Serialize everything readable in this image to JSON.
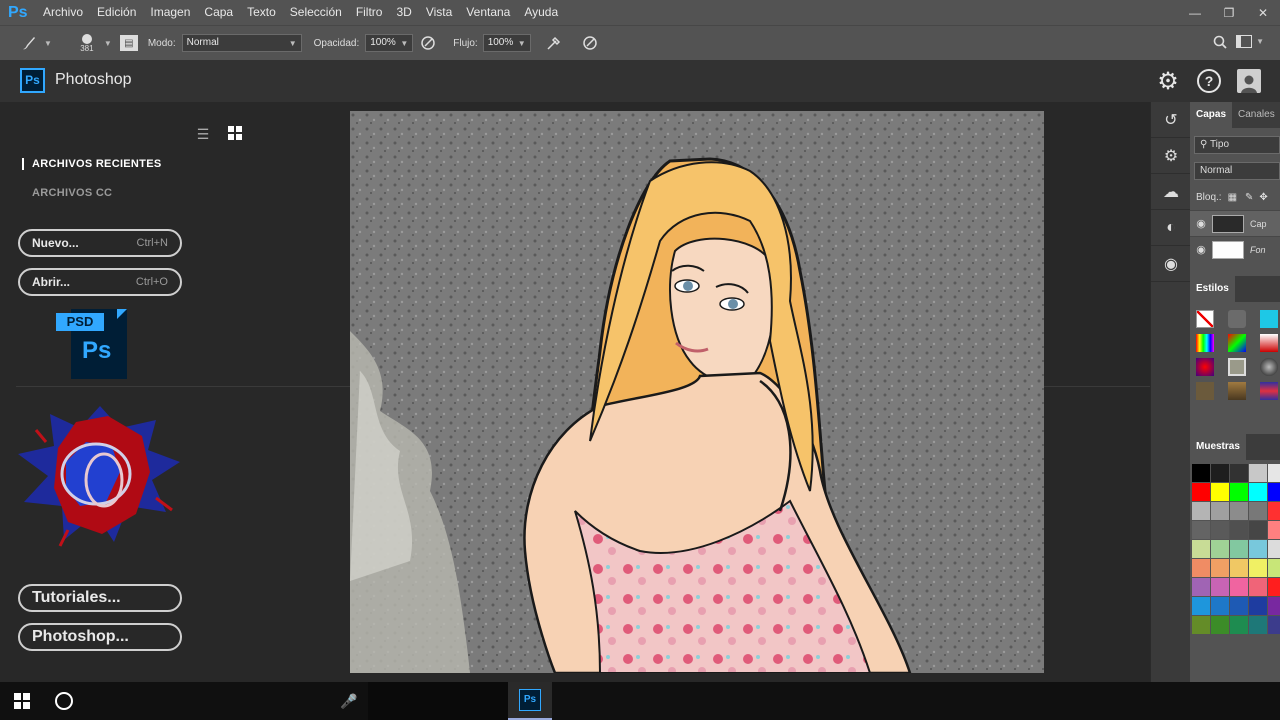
{
  "menubar": {
    "app_icon": "Ps",
    "items": [
      "Archivo",
      "Edición",
      "Imagen",
      "Capa",
      "Texto",
      "Selección",
      "Filtro",
      "3D",
      "Vista",
      "Ventana",
      "Ayuda"
    ],
    "window_controls": [
      "minimize-icon",
      "restore-icon",
      "close-icon"
    ]
  },
  "options": {
    "brush_size": "381",
    "mode_label": "Modo:",
    "mode_value": "Normal",
    "opacity_label": "Opacidad:",
    "opacity_value": "100%",
    "flow_label": "Flujo:",
    "flow_value": "100%"
  },
  "home": {
    "logo": "Ps",
    "title": "Photoshop",
    "nav_recent": "ARCHIVOS RECIENTES",
    "nav_cc": "ARCHIVOS CC",
    "new_label": "Nuevo...",
    "new_shortcut": "Ctrl+N",
    "open_label": "Abrir...",
    "open_shortcut": "Ctrl+O",
    "psd_badge": "PSD",
    "psd_logo": "Ps",
    "tutorials_label": "Tutoriales...",
    "photoshop_label": "Photoshop..."
  },
  "layers_panel": {
    "tab_layers": "Capas",
    "tab_channels": "Canales",
    "filter_value": "Tipo",
    "blend_mode": "Normal",
    "lock_label": "Bloq.:",
    "layers": [
      {
        "name": "Cap",
        "visible": true
      },
      {
        "name": "Fon",
        "visible": true
      }
    ]
  },
  "styles_panel": {
    "tab": "Estilos"
  },
  "swatches_panel": {
    "tab": "Muestras",
    "colors": [
      "#000000",
      "#1e1e1e",
      "#323232",
      "#c8c8c8",
      "#e6e6e6",
      "#ff0000",
      "#ffff00",
      "#00ff00",
      "#00ffff",
      "#0000ff",
      "#b4b4b4",
      "#a0a0a0",
      "#8c8c8c",
      "#787878",
      "#ff3030",
      "#646464",
      "#5a5a5a",
      "#505050",
      "#464646",
      "#ff8080",
      "#c8dc96",
      "#a0d296",
      "#82c8a0",
      "#78c8dc",
      "#dcdcdc",
      "#f08c64",
      "#f0a064",
      "#f0c864",
      "#f0f064",
      "#c8e678",
      "#a064b4",
      "#c864b4",
      "#f064a0",
      "#f06478",
      "#ff1e1e",
      "#1e96dc",
      "#1e78c8",
      "#1e5ab4",
      "#1e3ca0",
      "#7828a0",
      "#648c28",
      "#3c8c28",
      "#1e8c50",
      "#1e7878",
      "#3c3c8c"
    ]
  },
  "taskbar": {
    "ps_app": "Ps"
  }
}
